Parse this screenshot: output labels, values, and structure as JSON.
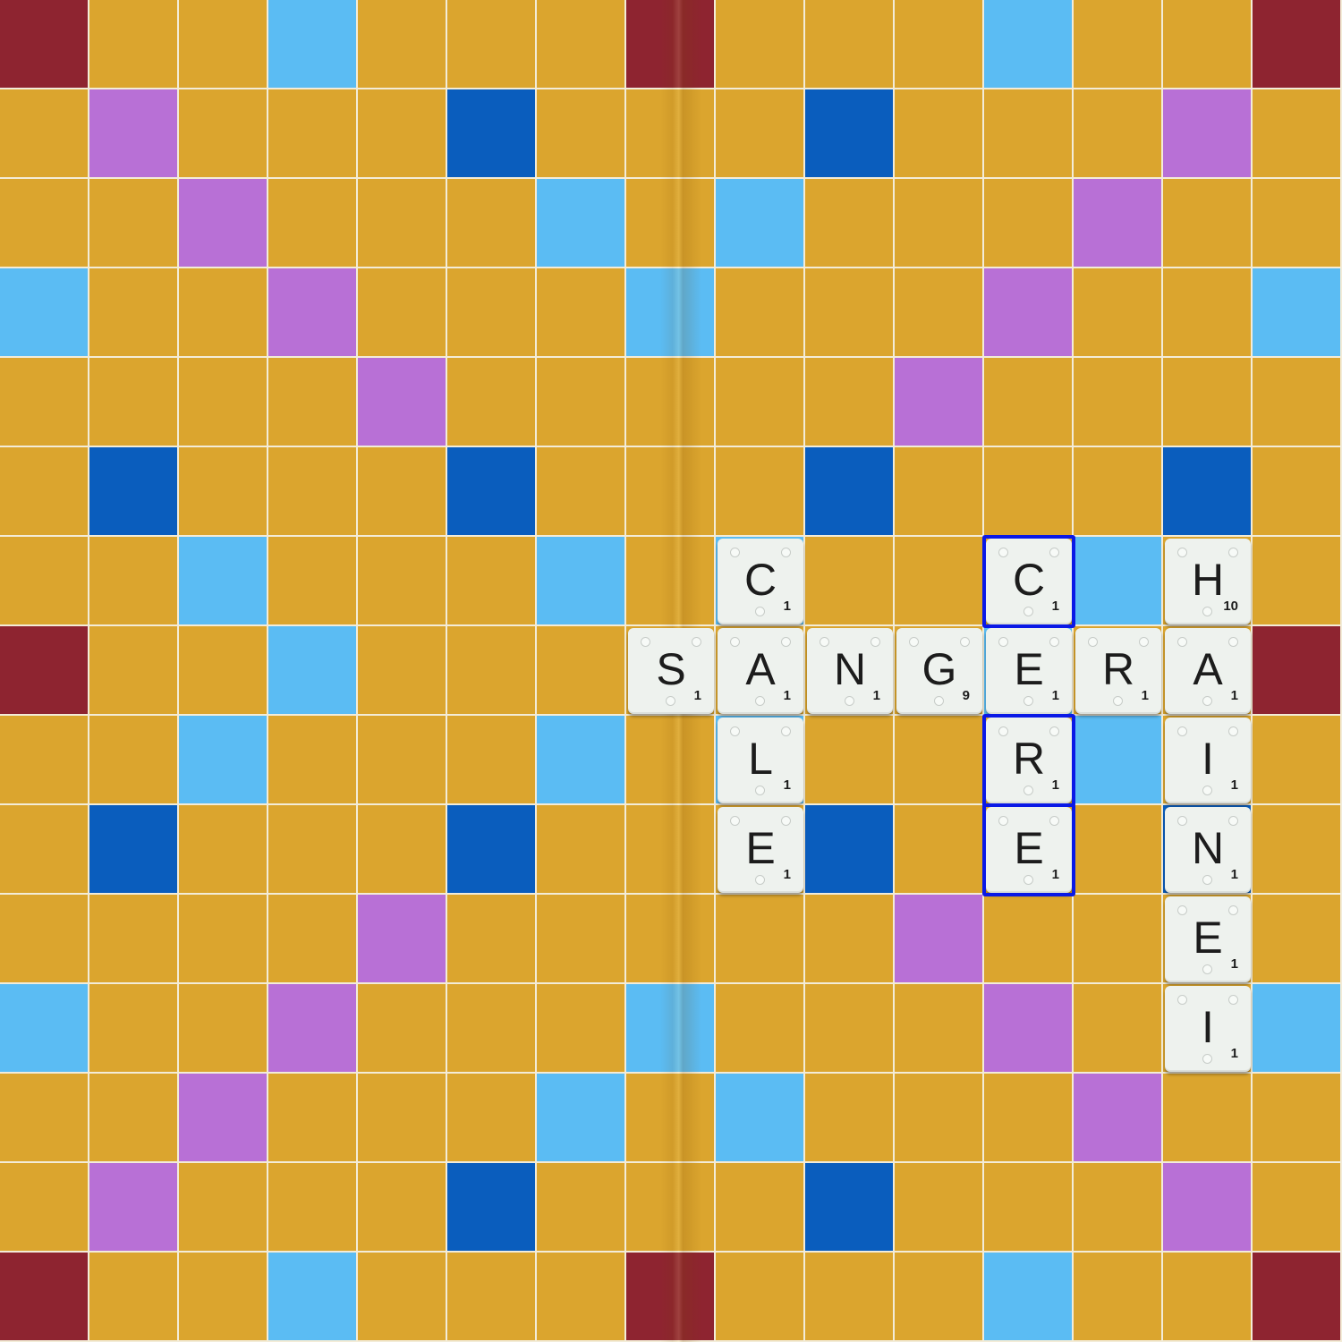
{
  "board": {
    "size": 15,
    "colors": {
      "plain": "#dba52e",
      "light_blue": "#5bbcf3",
      "dark_blue": "#0a5dbd",
      "pink": "#b870d6",
      "red": "#8e2430",
      "grid_line": "#f3ecd8",
      "tile": "#eef2ee",
      "highlight": "#0a19e6"
    },
    "premium_rows": [
      "R..L...R...L..R",
      ".P...D...D...P.",
      "..P...L.L...P..",
      "L..P...L...P..L",
      "....P.....P....",
      ".D...D...D...D.",
      "..L...L.L...L..",
      "R..L.......L..R",
      "..L...L.L...L..",
      ".D...D...D...D.",
      "....P.....P....",
      "L..P...L...P..L",
      "..P...L.L...P..",
      ".P...D...D...P.",
      "R..L...R...L..R"
    ],
    "premium_legend": {
      ".": "plain",
      "L": "light_blue",
      "D": "dark_blue",
      "P": "pink",
      "R": "red"
    }
  },
  "tiles": [
    {
      "letter": "C",
      "points": "1",
      "row": 6,
      "col": 8
    },
    {
      "letter": "C",
      "points": "1",
      "row": 6,
      "col": 11
    },
    {
      "letter": "H",
      "points": "10",
      "row": 6,
      "col": 13
    },
    {
      "letter": "S",
      "points": "1",
      "row": 7,
      "col": 7
    },
    {
      "letter": "A",
      "points": "1",
      "row": 7,
      "col": 8
    },
    {
      "letter": "N",
      "points": "1",
      "row": 7,
      "col": 9
    },
    {
      "letter": "G",
      "points": "9",
      "row": 7,
      "col": 10
    },
    {
      "letter": "E",
      "points": "1",
      "row": 7,
      "col": 11
    },
    {
      "letter": "R",
      "points": "1",
      "row": 7,
      "col": 12
    },
    {
      "letter": "A",
      "points": "1",
      "row": 7,
      "col": 13
    },
    {
      "letter": "L",
      "points": "1",
      "row": 8,
      "col": 8
    },
    {
      "letter": "R",
      "points": "1",
      "row": 8,
      "col": 11
    },
    {
      "letter": "I",
      "points": "1",
      "row": 8,
      "col": 13
    },
    {
      "letter": "E",
      "points": "1",
      "row": 9,
      "col": 8
    },
    {
      "letter": "E",
      "points": "1",
      "row": 9,
      "col": 11
    },
    {
      "letter": "N",
      "points": "1",
      "row": 9,
      "col": 13
    },
    {
      "letter": "E",
      "points": "1",
      "row": 10,
      "col": 13
    },
    {
      "letter": "I",
      "points": "1",
      "row": 11,
      "col": 13
    }
  ],
  "highlighted_cells": [
    {
      "row": 6,
      "col": 11
    },
    {
      "row": 8,
      "col": 11
    },
    {
      "row": 9,
      "col": 11
    }
  ]
}
